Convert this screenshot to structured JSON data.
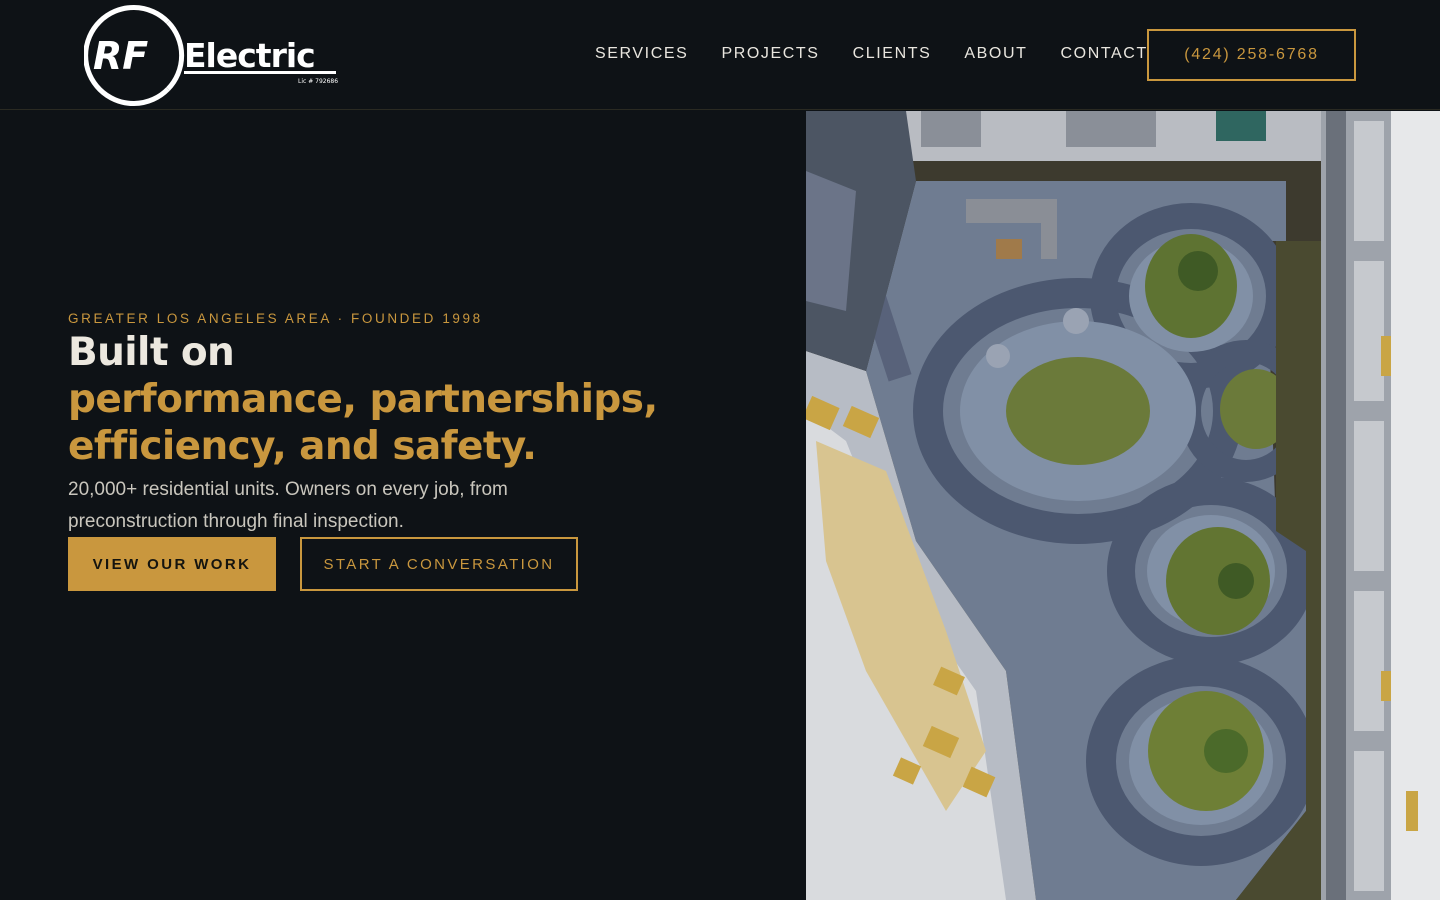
{
  "header": {
    "logo": {
      "mark_text": "RF",
      "word_text": "Electric",
      "license_text": "Lic # 792686",
      "icon": "rf-electric-logo"
    },
    "nav": [
      {
        "label": "SERVICES"
      },
      {
        "label": "PROJECTS"
      },
      {
        "label": "CLIENTS"
      },
      {
        "label": "ABOUT"
      },
      {
        "label": "CONTACT"
      }
    ],
    "phone_label": "(424) 258-6768"
  },
  "hero": {
    "eyebrow": "GREATER LOS ANGELES AREA · FOUNDED 1998",
    "headline_line1": "Built on",
    "headline_accent_1": "performance, partnerships,",
    "headline_accent_2": "efficiency, and safety.",
    "subtext": "20,000+ residential units. Owners on every job, from preconstruction through final inspection.",
    "primary_cta": "VIEW OUR WORK",
    "secondary_cta": "START A CONVERSATION",
    "image_icon": "aerial-courtyard-photo"
  },
  "colors": {
    "background": "#0e1216",
    "accent": "#c9973e",
    "text": "#e9e6df",
    "muted_text": "#c9c6bd"
  }
}
